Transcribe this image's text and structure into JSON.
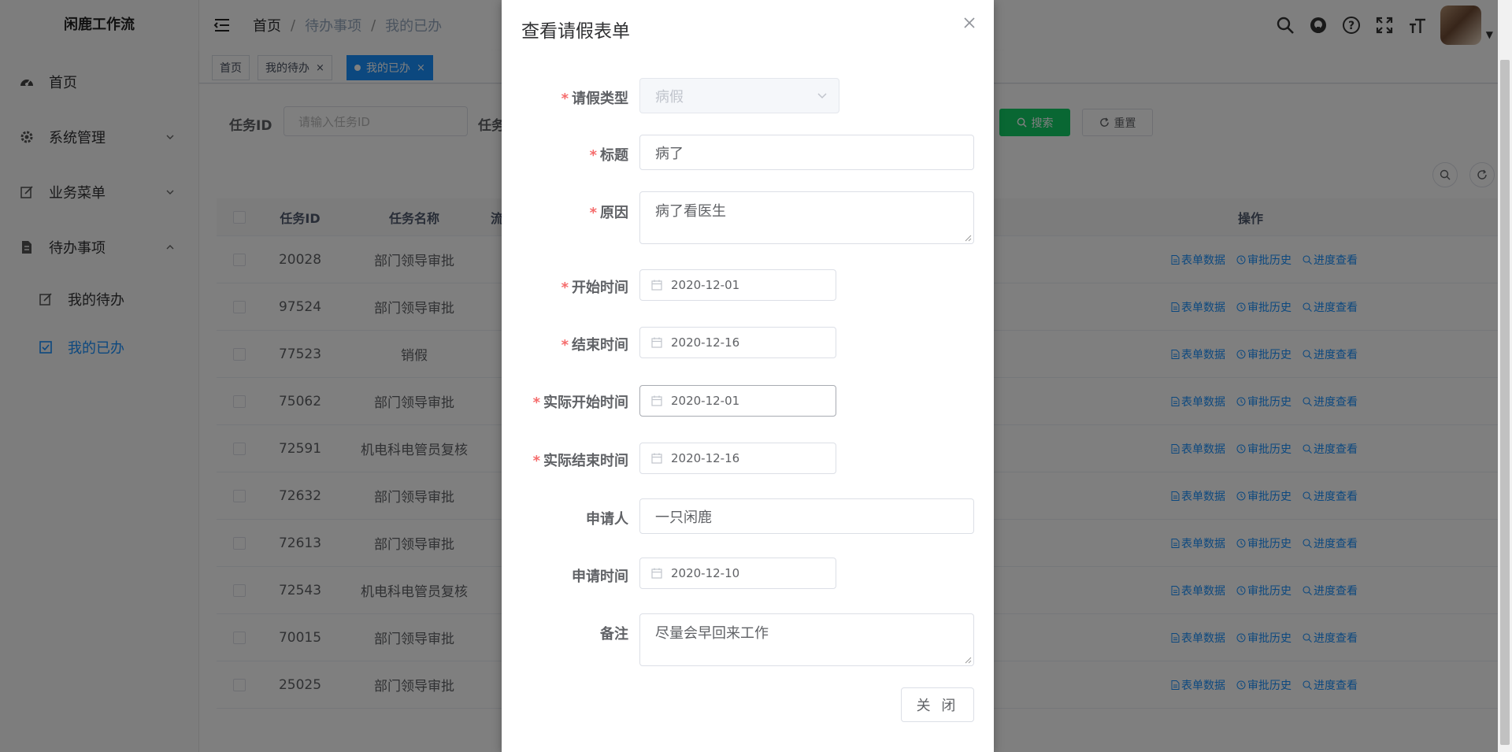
{
  "app": {
    "logo": "闲鹿工作流"
  },
  "sidebar": {
    "items": [
      {
        "label": "首页",
        "icon": "dashboard-icon"
      },
      {
        "label": "系统管理",
        "icon": "gear-icon"
      },
      {
        "label": "业务菜单",
        "icon": "edit-icon"
      },
      {
        "label": "待办事项",
        "icon": "document-icon"
      }
    ],
    "sub_items": [
      {
        "label": "我的待办",
        "icon": "edit-icon"
      },
      {
        "label": "我的已办",
        "icon": "checkbox-icon"
      }
    ]
  },
  "header": {
    "breadcrumb": [
      "首页",
      "待办事项",
      "我的已办"
    ]
  },
  "tags": [
    {
      "label": "首页"
    },
    {
      "label": "我的待办"
    },
    {
      "label": "我的已办"
    }
  ],
  "search": {
    "task_id_label": "任务ID",
    "task_id_placeholder": "请输入任务ID",
    "task_name_label": "任务",
    "search_label": "搜索",
    "reset_label": "重置"
  },
  "table": {
    "headers": {
      "id": "任务ID",
      "name": "任务名称",
      "flow": "流",
      "ops": "操作"
    },
    "op_labels": [
      "表单数据",
      "审批历史",
      "进度查看"
    ],
    "rows": [
      {
        "id": "20028",
        "name": "部门领导审批"
      },
      {
        "id": "97524",
        "name": "部门领导审批"
      },
      {
        "id": "77523",
        "name": "销假"
      },
      {
        "id": "75062",
        "name": "部门领导审批"
      },
      {
        "id": "72591",
        "name": "机电科电管员复核"
      },
      {
        "id": "72632",
        "name": "部门领导审批"
      },
      {
        "id": "72613",
        "name": "部门领导审批"
      },
      {
        "id": "72543",
        "name": "机电科电管员复核"
      },
      {
        "id": "70015",
        "name": "部门领导审批"
      },
      {
        "id": "25025",
        "name": "部门领导审批"
      }
    ]
  },
  "dialog": {
    "title": "查看请假表单",
    "fields": {
      "leave_type": {
        "label": "请假类型",
        "value": "病假"
      },
      "title": {
        "label": "标题",
        "value": "病了"
      },
      "reason": {
        "label": "原因",
        "value": "病了看医生"
      },
      "start_time": {
        "label": "开始时间",
        "value": "2020-12-01"
      },
      "end_time": {
        "label": "结束时间",
        "value": "2020-12-16"
      },
      "actual_start": {
        "label": "实际开始时间",
        "value": "2020-12-01"
      },
      "actual_end": {
        "label": "实际结束时间",
        "value": "2020-12-16"
      },
      "applicant": {
        "label": "申请人",
        "value": "一只闲鹿"
      },
      "apply_time": {
        "label": "申请时间",
        "value": "2020-12-10"
      },
      "remark": {
        "label": "备注",
        "value": "尽量会早回来工作"
      }
    },
    "close_label": "关 闭"
  },
  "colors": {
    "accent": "#1890ff",
    "success": "#13ce66",
    "required": "#f56c6c"
  }
}
